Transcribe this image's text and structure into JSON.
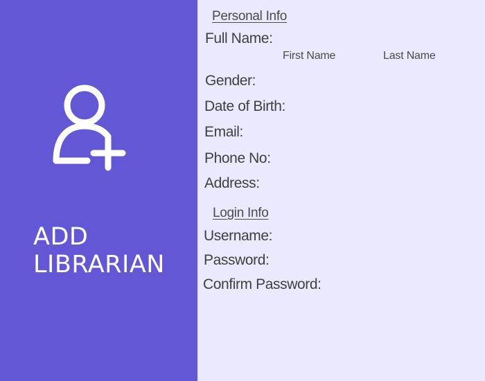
{
  "colors": {
    "left_panel_bg": "#6258d6",
    "right_panel_bg": "#eaeafe",
    "label_text": "#3f3f3f",
    "title_text": "#ffffff"
  },
  "sidebar": {
    "icon": "add-user-icon",
    "title": "ADD\nLIBRARIAN"
  },
  "personal_info": {
    "heading": "Personal Info",
    "full_name_label": "Full Name:",
    "first_name_label": "First Name",
    "last_name_label": "Last Name",
    "gender_label": "Gender:",
    "dob_label": "Date of Birth:",
    "email_label": "Email:",
    "phone_label": "Phone No:",
    "address_label": "Address:"
  },
  "login_info": {
    "heading": "Login Info",
    "username_label": "Username:",
    "password_label": "Password:",
    "confirm_password_label": "Confirm Password:"
  }
}
